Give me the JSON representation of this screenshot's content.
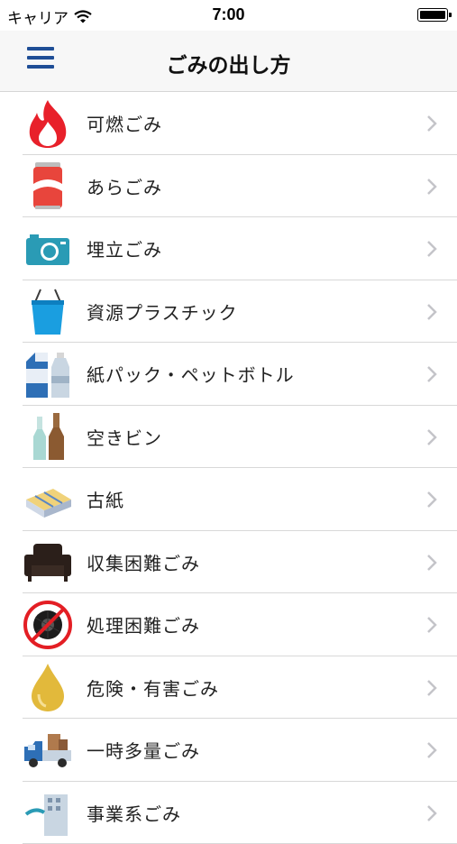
{
  "status_bar": {
    "carrier": "キャリア",
    "time": "7:00"
  },
  "nav": {
    "title": "ごみの出し方",
    "menu_icon": "hamburger-menu-icon"
  },
  "categories": [
    {
      "label": "可燃ごみ",
      "icon": "flame-icon"
    },
    {
      "label": "あらごみ",
      "icon": "can-icon"
    },
    {
      "label": "埋立ごみ",
      "icon": "camera-icon"
    },
    {
      "label": "資源プラスチック",
      "icon": "bucket-icon"
    },
    {
      "label": "紙パック・ペットボトル",
      "icon": "milk-carton-bottle-icon"
    },
    {
      "label": "空きビン",
      "icon": "bottles-icon"
    },
    {
      "label": "古紙",
      "icon": "newspaper-bundle-icon"
    },
    {
      "label": "収集困難ごみ",
      "icon": "sofa-icon"
    },
    {
      "label": "処理困難ごみ",
      "icon": "no-tire-icon"
    },
    {
      "label": "危険・有害ごみ",
      "icon": "oil-drop-icon"
    },
    {
      "label": "一時多量ごみ",
      "icon": "truck-icon"
    },
    {
      "label": "事業系ごみ",
      "icon": "building-icon"
    }
  ],
  "colors": {
    "accent": "#1f4e96",
    "flame": "#e8202a",
    "camera": "#2a9bb5",
    "bucket": "#1a9ee0",
    "oil": "#e2b93b"
  }
}
